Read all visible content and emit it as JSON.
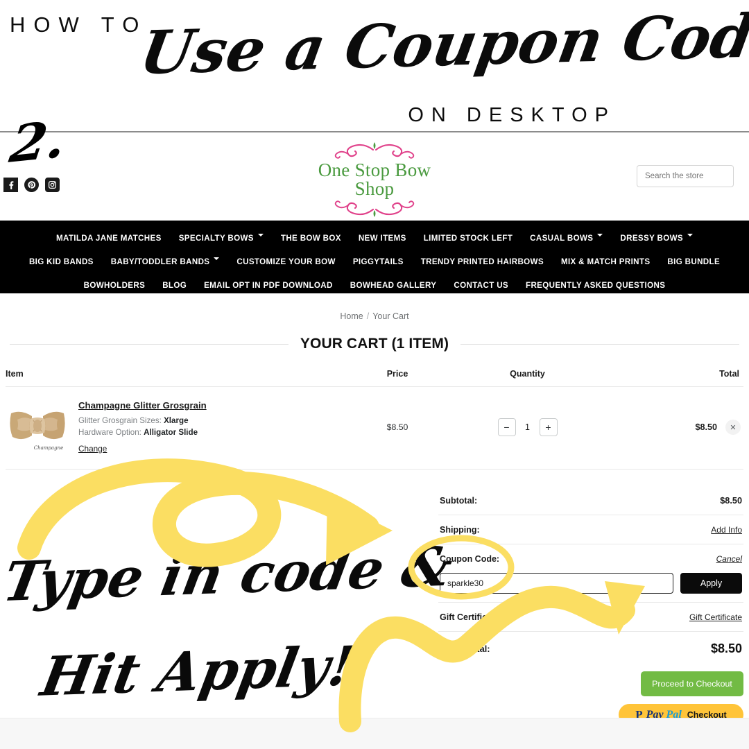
{
  "banner": {
    "how_to": "HOW TO",
    "script_title": "Use a Coupon Code",
    "on_desktop": "ON DESKTOP",
    "step_number": "2."
  },
  "annotations": {
    "line1": "Type in code &",
    "line2": "Hit Apply!",
    "highlight_color": "#FBDE62",
    "arrow_to_input_label": "arrow pointing to coupon code input",
    "circle_label": "circle highlight around coupon code field",
    "arrow_to_apply_label": "arrow pointing to Apply button"
  },
  "header": {
    "logo_text": "One Stop Bow Shop",
    "logo_text_color": "#4a9a3f",
    "logo_ornament_color": "#e0418a",
    "social": [
      {
        "name": "facebook-icon",
        "glyph": "f"
      },
      {
        "name": "pinterest-icon",
        "glyph": "p"
      },
      {
        "name": "instagram-icon",
        "glyph": "▣"
      }
    ],
    "search": {
      "placeholder": "Search the store",
      "value": ""
    }
  },
  "nav": {
    "rows": [
      [
        {
          "label": "MATILDA JANE MATCHES",
          "dropdown": false
        },
        {
          "label": "SPECIALTY BOWS",
          "dropdown": true
        },
        {
          "label": "THE BOW BOX",
          "dropdown": false
        },
        {
          "label": "NEW ITEMS",
          "dropdown": false
        },
        {
          "label": "LIMITED STOCK LEFT",
          "dropdown": false
        },
        {
          "label": "CASUAL BOWS",
          "dropdown": true
        },
        {
          "label": "DRESSY BOWS",
          "dropdown": true
        }
      ],
      [
        {
          "label": "BIG KID BANDS",
          "dropdown": false
        },
        {
          "label": "BABY/TODDLER BANDS",
          "dropdown": true
        },
        {
          "label": "CUSTOMIZE YOUR BOW",
          "dropdown": false
        },
        {
          "label": "PIGGYTAILS",
          "dropdown": false
        },
        {
          "label": "TRENDY PRINTED HAIRBOWS",
          "dropdown": false
        },
        {
          "label": "MIX & MATCH PRINTS",
          "dropdown": false
        },
        {
          "label": "BIG BUNDLE",
          "dropdown": false
        }
      ],
      [
        {
          "label": "BOWHOLDERS",
          "dropdown": false
        },
        {
          "label": "BLOG",
          "dropdown": false
        },
        {
          "label": "EMAIL OPT IN PDF DOWNLOAD",
          "dropdown": false
        },
        {
          "label": "BOWHEAD GALLERY",
          "dropdown": false
        },
        {
          "label": "CONTACT US",
          "dropdown": false
        },
        {
          "label": "FREQUENTLY ASKED QUESTIONS",
          "dropdown": false
        }
      ]
    ]
  },
  "breadcrumb": {
    "home": "Home",
    "separator": "/",
    "current": "Your Cart"
  },
  "cart": {
    "title": "YOUR CART (1 ITEM)",
    "columns": {
      "item": "Item",
      "price": "Price",
      "quantity": "Quantity",
      "total": "Total"
    },
    "rows": [
      {
        "product_name": "Champagne Glitter Grosgrain",
        "option1_label": "Glitter Grosgrain Sizes:",
        "option1_value": "Xlarge",
        "option2_label": "Hardware Option:",
        "option2_value": "Alligator Slide",
        "change_label": "Change",
        "price": "$8.50",
        "qty_decrement": "−",
        "quantity": "1",
        "qty_increment": "+",
        "total": "$8.50",
        "remove_glyph": "✕",
        "thumb_caption": "Champagne",
        "thumb_color": "#c9a877"
      }
    ]
  },
  "summary": {
    "subtotal_label": "Subtotal:",
    "subtotal_value": "$8.50",
    "shipping_label": "Shipping:",
    "shipping_link": "Add Info",
    "coupon_label": "Coupon Code:",
    "coupon_cancel": "Cancel",
    "coupon_value": "sparkle30",
    "coupon_placeholder": "",
    "apply_label": "Apply",
    "gift_label": "Gift Certificate:",
    "gift_link": "Gift Certificate",
    "grand_label": "Grand total:",
    "grand_value": "$8.50",
    "checkout_label": "Proceed to Checkout",
    "checkout_color": "#72bb44",
    "paypal": {
      "mark": "P",
      "pay": "Pay",
      "pal": "Pal",
      "checkout": "Checkout",
      "bg": "#ffc439"
    }
  }
}
